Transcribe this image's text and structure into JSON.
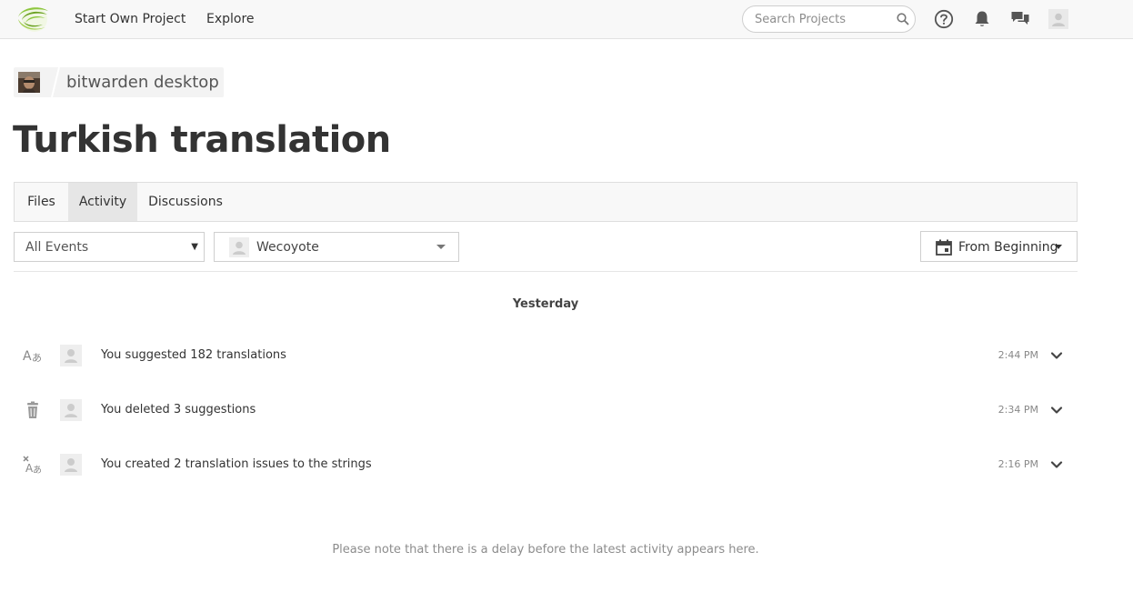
{
  "header": {
    "logo_icon": "crowdin-logo-icon",
    "nav": [
      {
        "label": "Start Own Project"
      },
      {
        "label": "Explore"
      }
    ],
    "search": {
      "placeholder": "Search Projects",
      "icon": "search-icon"
    },
    "icons": [
      "help-icon",
      "bell-icon",
      "chat-icon",
      "user-avatar-icon"
    ]
  },
  "breadcrumb": {
    "project_name": "bitwarden desktop"
  },
  "page_title": "Turkish translation",
  "tabs": [
    {
      "label": "Files",
      "active": false
    },
    {
      "label": "Activity",
      "active": true
    },
    {
      "label": "Discussions",
      "active": false
    }
  ],
  "filters": {
    "events": {
      "selected": "All Events"
    },
    "user": {
      "selected": "Wecoyote"
    },
    "date": {
      "selected": "From Beginning"
    }
  },
  "activity": {
    "day_heading": "Yesterday",
    "items": [
      {
        "icon": "translate-icon",
        "text": "You suggested 182 translations",
        "time": "2:44 PM"
      },
      {
        "icon": "trash-icon",
        "text": "You deleted 3 suggestions",
        "time": "2:34 PM"
      },
      {
        "icon": "translation-issue-icon",
        "text": "You created 2 translation issues to the strings",
        "time": "2:16 PM"
      }
    ]
  },
  "footnote": "Please note that there is a delay before the latest activity appears here.",
  "colors": {
    "brand_green": "#8dc63f",
    "topbar_bg": "#f8f8f8",
    "active_tab_bg": "#e6e6e6",
    "muted_text": "#8c8c8c"
  }
}
